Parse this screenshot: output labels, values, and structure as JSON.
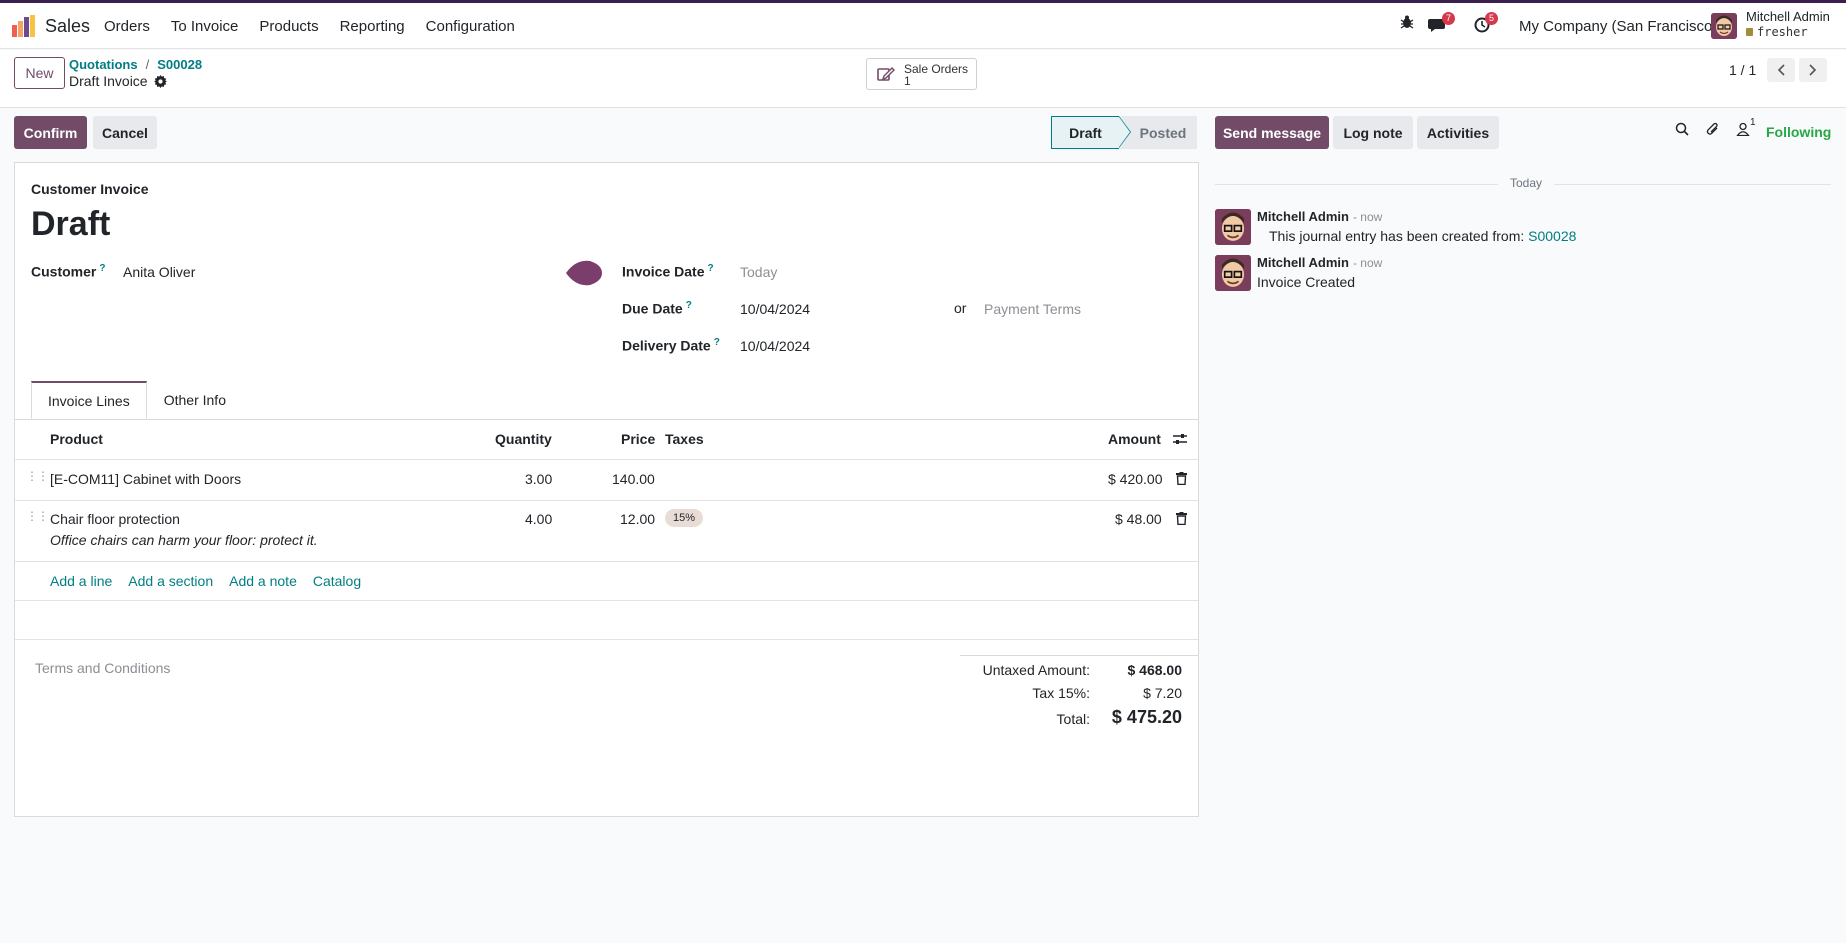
{
  "navbar": {
    "app_name": "Sales",
    "menu": [
      "Orders",
      "To Invoice",
      "Products",
      "Reporting",
      "Configuration"
    ],
    "messages_badge": "7",
    "activities_badge": "5",
    "company": "My Company (San Francisco)",
    "user_name": "Mitchell Admin",
    "user_db": "fresher"
  },
  "control_panel": {
    "new_label": "New",
    "breadcrumb": [
      "Quotations",
      "S00028"
    ],
    "record_title": "Draft Invoice",
    "smart_button": {
      "label": "Sale Orders",
      "count": "1"
    },
    "pager": "1 / 1"
  },
  "actions": {
    "confirm": "Confirm",
    "cancel": "Cancel",
    "status": [
      "Draft",
      "Posted"
    ]
  },
  "form": {
    "doc_type": "Customer Invoice",
    "title": "Draft",
    "customer_label": "Customer",
    "customer": "Anita Oliver",
    "invoice_date_label": "Invoice Date",
    "invoice_date_placeholder": "Today",
    "due_date_label": "Due Date",
    "due_date": "10/04/2024",
    "or": "or",
    "payment_terms_placeholder": "Payment Terms",
    "delivery_date_label": "Delivery Date",
    "delivery_date": "10/04/2024",
    "help": "?"
  },
  "tabs": [
    "Invoice Lines",
    "Other Info"
  ],
  "lines": {
    "headers": {
      "product": "Product",
      "quantity": "Quantity",
      "price": "Price",
      "taxes": "Taxes",
      "amount": "Amount"
    },
    "rows": [
      {
        "product": "[E-COM11] Cabinet with Doors",
        "quantity": "3.00",
        "price": "140.00",
        "tax": "",
        "amount": "$ 420.00"
      },
      {
        "product": "Chair floor protection",
        "quantity": "4.00",
        "price": "12.00",
        "tax": "15%",
        "amount": "$ 48.00",
        "note": "Office chairs can harm your floor: protect it."
      }
    ],
    "add_links": [
      "Add a line",
      "Add a section",
      "Add a note",
      "Catalog"
    ]
  },
  "footer": {
    "terms_placeholder": "Terms and Conditions",
    "untaxed_label": "Untaxed Amount:",
    "untaxed": "$ 468.00",
    "tax_label": "Tax 15%:",
    "tax": "$ 7.20",
    "total_label": "Total:",
    "total": "$ 475.20"
  },
  "chatter": {
    "send": "Send message",
    "log": "Log note",
    "activities": "Activities",
    "followers_count": "1",
    "following": "Following",
    "today": "Today",
    "messages": [
      {
        "author": "Mitchell Admin",
        "time": "- now",
        "body": "This journal entry has been created from: ",
        "link": "S00028"
      },
      {
        "author": "Mitchell Admin",
        "time": "- now",
        "body": "Invoice Created"
      }
    ]
  }
}
